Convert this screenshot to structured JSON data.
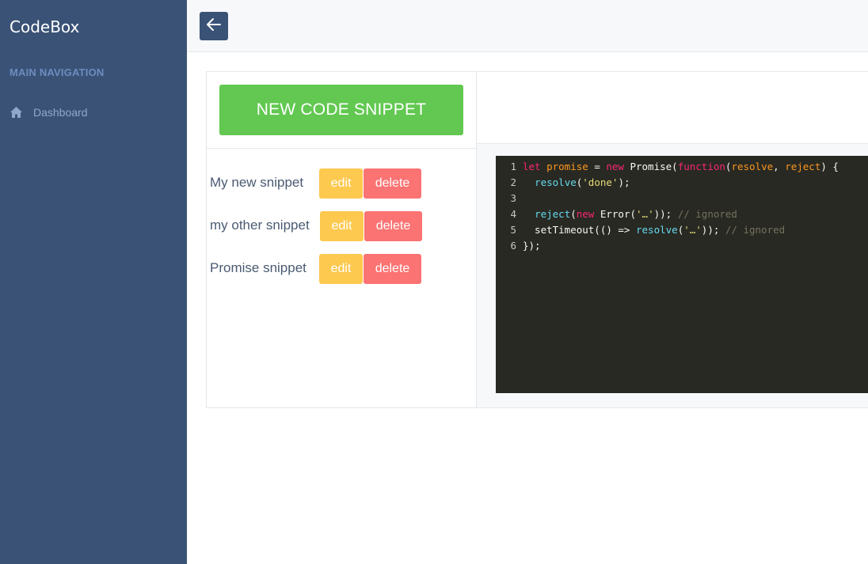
{
  "app": {
    "title": "CodeBox"
  },
  "sidebar": {
    "header": "MAIN NAVIGATION",
    "items": [
      {
        "label": "Dashboard",
        "icon": "home-icon"
      }
    ],
    "background": "#3a5276"
  },
  "topbar": {
    "back_icon": "arrow-left-icon"
  },
  "main": {
    "new_button": "NEW CODE SNIPPET",
    "snippets": [
      {
        "name": "My new snippet",
        "edit": "edit",
        "delete": "delete"
      },
      {
        "name": "my other snippet",
        "edit": "edit",
        "delete": "delete"
      },
      {
        "name": "Promise snippet",
        "edit": "edit",
        "delete": "delete"
      }
    ]
  },
  "code": {
    "lines": [
      {
        "n": "1",
        "text": "let promise = new Promise(function(resolve, reject) {"
      },
      {
        "n": "2",
        "text": "  resolve('done');"
      },
      {
        "n": "3",
        "text": ""
      },
      {
        "n": "4",
        "text": "  reject(new Error('…')); // ignored"
      },
      {
        "n": "5",
        "text": "  setTimeout(() => resolve('…')); // ignored"
      },
      {
        "n": "6",
        "text": "});"
      }
    ]
  },
  "colors": {
    "new_button": "#62c851",
    "edit_button": "#fdc94f",
    "delete_button": "#fb7373",
    "code_bg": "#282923"
  }
}
